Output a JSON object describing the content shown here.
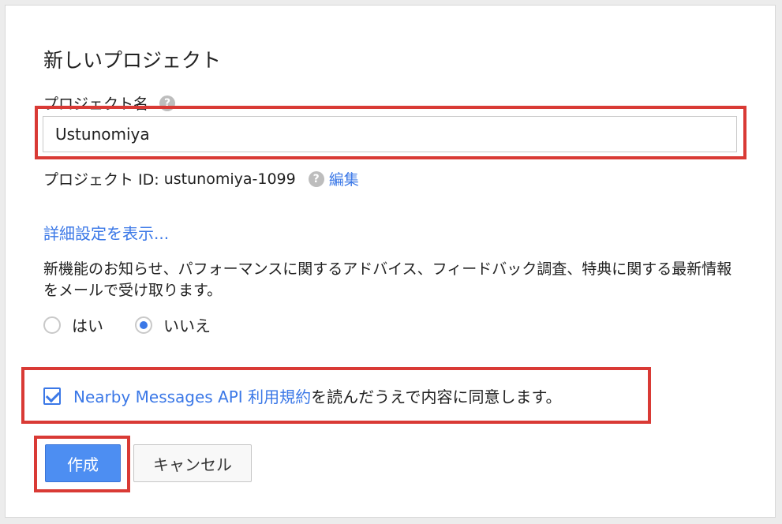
{
  "dialog": {
    "title": "新しいプロジェクト",
    "project_name_label": "プロジェクト名",
    "help_icon_glyph": "?",
    "project_name_value": "Ustunomiya",
    "project_id_label": "プロジェクト ID:",
    "project_id_value": "ustunomiya-1099",
    "edit_link": "編集",
    "advanced_link": "詳細設定を表示...",
    "email_optin_text": "新機能のお知らせ、パフォーマンスに関するアドバイス、フィードバック調査、特典に関する最新情報をメールで受け取ります。",
    "radio_yes": "はい",
    "radio_no": "いいえ",
    "radio_selected": "いいえ",
    "tos_link": "Nearby Messages API 利用規約",
    "tos_text": "を読んだうえで内容に同意します。",
    "tos_checked": true,
    "create_button": "作成",
    "cancel_button": "キャンセル"
  },
  "colors": {
    "accent": "#3b78e7",
    "primary_button": "#4d8ef2",
    "highlight_outline": "#d93a35"
  }
}
